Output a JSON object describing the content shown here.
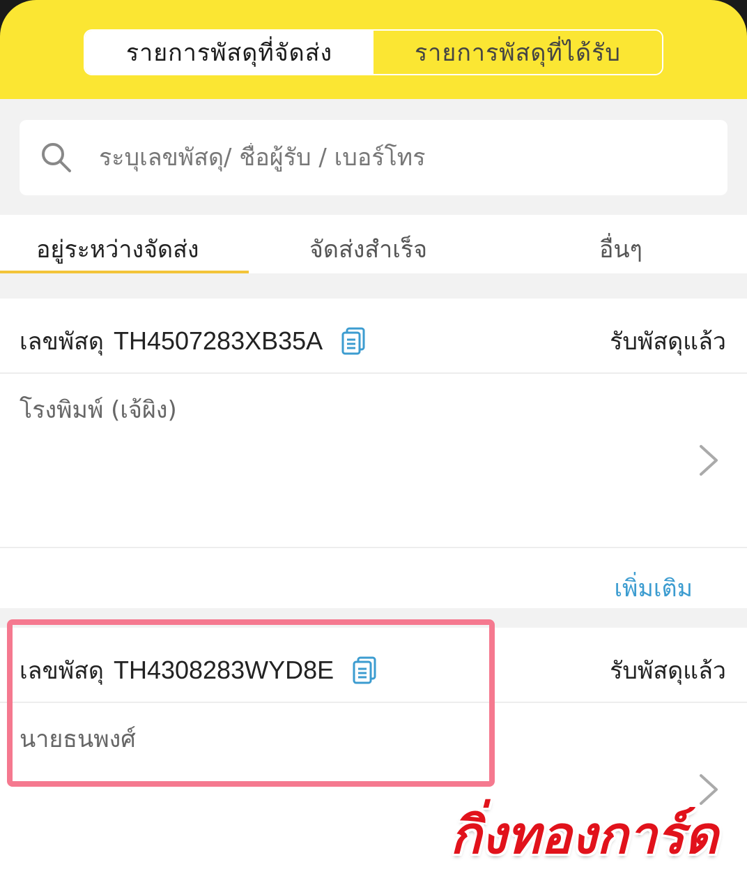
{
  "segment": {
    "sent_label": "รายการพัสดุที่จัดส่ง",
    "received_label": "รายการพัสดุที่ได้รับ"
  },
  "search": {
    "placeholder": "ระบุเลขพัสดุ/ ชื่อผู้รับ / เบอร์โทร"
  },
  "tabs": [
    {
      "label": "อยู่ระหว่างจัดส่ง",
      "active": true
    },
    {
      "label": "จัดส่งสำเร็จ",
      "active": false
    },
    {
      "label": "อื่นๆ",
      "active": false
    }
  ],
  "parcels": [
    {
      "tracking_prefix": "เลขพัสดุ",
      "tracking_number": "TH4507283XB35A",
      "status": "รับพัสดุแล้ว",
      "receiver": "โรงพิมพ์ (เจ้ผิง)",
      "more_label": "เพิ่มเติม"
    },
    {
      "tracking_prefix": "เลขพัสดุ",
      "tracking_number": "TH4308283WYD8E",
      "status": "รับพัสดุแล้ว",
      "receiver": "นายธนพงศ์"
    }
  ],
  "watermark": "กิ่งทองการ์ด",
  "colors": {
    "brand_yellow": "#fbe633",
    "link_blue": "#3c9cd0",
    "highlight_pink": "#f5798f",
    "tab_underline": "#f3c43a"
  }
}
